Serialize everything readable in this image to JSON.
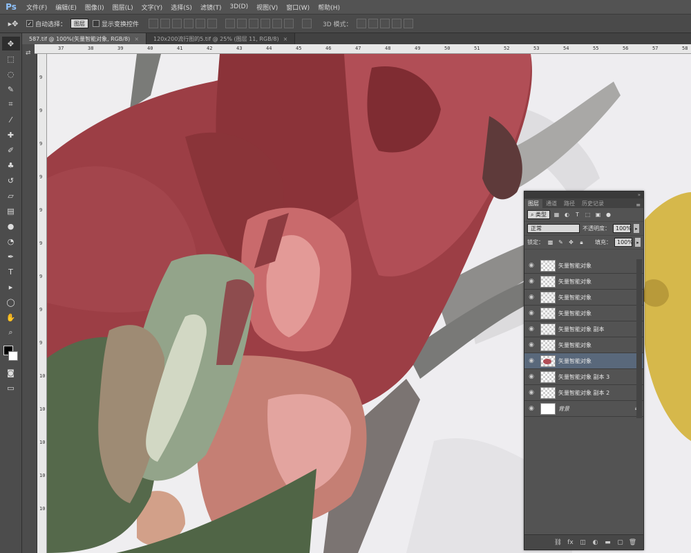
{
  "app": {
    "logo": "Ps"
  },
  "menu": [
    "文件(F)",
    "编辑(E)",
    "图像(I)",
    "图层(L)",
    "文字(Y)",
    "选择(S)",
    "滤镜(T)",
    "3D(D)",
    "视图(V)",
    "窗口(W)",
    "帮助(H)"
  ],
  "options": {
    "auto_select_label": "自动选择：",
    "auto_select_value": "图层",
    "show_transform_label": "显示变换控件",
    "mode_3d_label": "3D 模式："
  },
  "tabs": [
    {
      "label": "587.tif @ 100%(矢量智能对象, RGB/8)",
      "active": true
    },
    {
      "label": "120x200流行图的5.tif @ 25% (图层 11, RGB/8)",
      "active": false
    }
  ],
  "ruler_h_labels": [
    "37",
    "38",
    "39",
    "40",
    "41",
    "42",
    "43",
    "44",
    "45",
    "46",
    "47",
    "48",
    "49",
    "50",
    "51",
    "52",
    "53",
    "54",
    "55",
    "56",
    "57",
    "58"
  ],
  "ruler_v_labels": [
    "9",
    "9",
    "9",
    "9",
    "9",
    "9",
    "9",
    "9",
    "9",
    "10",
    "10",
    "10",
    "10",
    "10"
  ],
  "layers_panel": {
    "tabs": [
      "图层",
      "通道",
      "路径",
      "历史记录"
    ],
    "filter_label": "类型",
    "blend_mode": "正常",
    "opacity_label": "不透明度：",
    "opacity_value": "100%",
    "lock_label": "锁定：",
    "fill_label": "填充：",
    "fill_value": "100%",
    "layers": [
      {
        "name": "矢量智能对象",
        "thumb": "transparent",
        "selected": false
      },
      {
        "name": "矢量智能对象",
        "thumb": "transparent",
        "selected": false
      },
      {
        "name": "矢量智能对象",
        "thumb": "transparent",
        "selected": false
      },
      {
        "name": "矢量智能对象",
        "thumb": "transparent",
        "selected": false
      },
      {
        "name": "矢量智能对象 副本",
        "thumb": "transparent",
        "selected": false
      },
      {
        "name": "矢量智能对象",
        "thumb": "transparent",
        "selected": false
      },
      {
        "name": "矢量智能对象",
        "thumb": "flower",
        "selected": true
      },
      {
        "name": "矢量智能对象 副本 3",
        "thumb": "transparent",
        "selected": false
      },
      {
        "name": "矢量智能对象 副本 2",
        "thumb": "transparent",
        "selected": false
      },
      {
        "name": "背景",
        "thumb": "white",
        "selected": false
      }
    ]
  },
  "colors": {
    "selected_layer": "#59687b",
    "panel_bg": "#535353"
  }
}
